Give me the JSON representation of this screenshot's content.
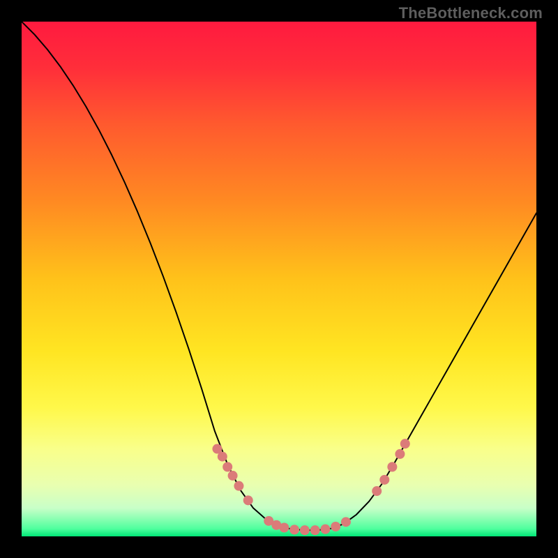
{
  "watermark": "TheBottleneck.com",
  "chart_data": {
    "type": "line",
    "title": "",
    "xlabel": "",
    "ylabel": "",
    "xlim": [
      0,
      100
    ],
    "ylim": [
      0,
      100
    ],
    "background_gradient": {
      "stops": [
        {
          "offset": 0.0,
          "color": "#ff1a3f"
        },
        {
          "offset": 0.09,
          "color": "#ff2e3a"
        },
        {
          "offset": 0.2,
          "color": "#ff5a2e"
        },
        {
          "offset": 0.35,
          "color": "#ff8a22"
        },
        {
          "offset": 0.5,
          "color": "#ffc21a"
        },
        {
          "offset": 0.64,
          "color": "#ffe522"
        },
        {
          "offset": 0.75,
          "color": "#fff84a"
        },
        {
          "offset": 0.83,
          "color": "#f9ff8a"
        },
        {
          "offset": 0.9,
          "color": "#e9ffb0"
        },
        {
          "offset": 0.945,
          "color": "#c8ffc8"
        },
        {
          "offset": 0.965,
          "color": "#8dffb3"
        },
        {
          "offset": 0.985,
          "color": "#4fff9e"
        },
        {
          "offset": 1.0,
          "color": "#00e676"
        }
      ]
    },
    "series": [
      {
        "name": "bottleneck-curve",
        "color": "#000000",
        "stroke_width": 2,
        "x": [
          0.0,
          2.5,
          5.0,
          7.5,
          10.0,
          12.5,
          15.0,
          17.5,
          20.0,
          22.5,
          25.0,
          27.5,
          30.0,
          32.5,
          35.0,
          37.5,
          40.0,
          42.5,
          45.0,
          47.5,
          50.0,
          52.5,
          55.0,
          57.5,
          60.0,
          62.5,
          65.0,
          67.5,
          70.0,
          72.5,
          75.0,
          77.5,
          80.0,
          82.5,
          85.0,
          87.5,
          90.0,
          92.5,
          95.0,
          97.5,
          100.0
        ],
        "y": [
          100.0,
          97.5,
          94.6,
          91.3,
          87.6,
          83.5,
          79.0,
          74.1,
          68.8,
          63.1,
          57.0,
          50.5,
          43.6,
          36.3,
          28.6,
          20.5,
          14.0,
          9.0,
          5.5,
          3.3,
          2.0,
          1.4,
          1.2,
          1.2,
          1.5,
          2.4,
          4.2,
          6.8,
          10.2,
          14.4,
          18.8,
          23.2,
          27.6,
          32.0,
          36.4,
          40.8,
          45.2,
          49.6,
          54.0,
          58.4,
          62.8
        ]
      }
    ],
    "dot_overlay": {
      "color": "#db7b79",
      "radius": 7,
      "points": [
        {
          "x": 38.0,
          "y": 17.0
        },
        {
          "x": 39.0,
          "y": 15.5
        },
        {
          "x": 40.0,
          "y": 13.5
        },
        {
          "x": 41.0,
          "y": 11.8
        },
        {
          "x": 42.2,
          "y": 9.8
        },
        {
          "x": 44.0,
          "y": 7.0
        },
        {
          "x": 48.0,
          "y": 3.0
        },
        {
          "x": 49.5,
          "y": 2.2
        },
        {
          "x": 51.0,
          "y": 1.7
        },
        {
          "x": 53.0,
          "y": 1.3
        },
        {
          "x": 55.0,
          "y": 1.2
        },
        {
          "x": 57.0,
          "y": 1.2
        },
        {
          "x": 59.0,
          "y": 1.4
        },
        {
          "x": 61.0,
          "y": 1.9
        },
        {
          "x": 63.0,
          "y": 2.8
        },
        {
          "x": 69.0,
          "y": 8.8
        },
        {
          "x": 70.5,
          "y": 11.0
        },
        {
          "x": 72.0,
          "y": 13.5
        },
        {
          "x": 73.5,
          "y": 16.0
        },
        {
          "x": 74.5,
          "y": 18.0
        }
      ]
    }
  }
}
